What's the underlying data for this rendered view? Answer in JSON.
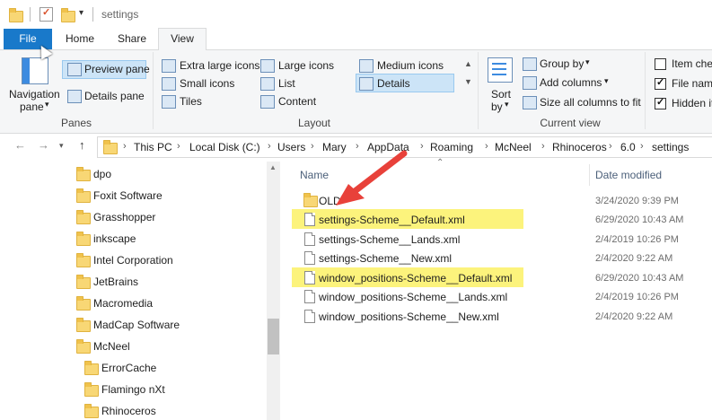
{
  "title_bar": {
    "path_label": "settings"
  },
  "tabs": [
    "File",
    "Home",
    "Share",
    "View"
  ],
  "ribbon": {
    "panes": {
      "navigation_pane_line1": "Navigation",
      "navigation_pane_line2": "pane",
      "preview_pane": "Preview pane",
      "details_pane": "Details pane",
      "label": "Panes"
    },
    "layout": {
      "items": [
        "Extra large icons",
        "Large icons",
        "Medium icons",
        "Small icons",
        "List",
        "Details",
        "Tiles",
        "Content"
      ],
      "selected": "Details",
      "label": "Layout"
    },
    "current_view": {
      "sort_by_line1": "Sort",
      "sort_by_line2": "by",
      "group_by": "Group by",
      "add_columns": "Add columns",
      "size_all_columns": "Size all columns to fit",
      "label": "Current view"
    },
    "show_hide": {
      "item_check_boxes": "Item chec",
      "file_name_extensions": "File nam",
      "hidden_items": "Hidden it"
    }
  },
  "address": {
    "crumbs": [
      "This PC",
      "Local Disk (C:)",
      "Users",
      "Mary",
      "AppData",
      "Roaming",
      "McNeel",
      "Rhinoceros",
      "6.0",
      "settings"
    ]
  },
  "nav_tree": [
    "dpo",
    "Foxit Software",
    "Grasshopper",
    "inkscape",
    "Intel Corporation",
    "JetBrains",
    "Macromedia",
    "MadCap Software",
    "McNeel",
    "ErrorCache",
    "Flamingo nXt",
    "Rhinoceros"
  ],
  "columns": {
    "name": "Name",
    "date_modified": "Date modified"
  },
  "files": [
    {
      "name": "OLD",
      "date": "3/24/2020 9:39 PM",
      "type": "folder",
      "highlight": false
    },
    {
      "name": "settings-Scheme__Default.xml",
      "date": "6/29/2020 10:43 AM",
      "type": "file",
      "highlight": true
    },
    {
      "name": "settings-Scheme__Lands.xml",
      "date": "2/4/2019 10:26 PM",
      "type": "file",
      "highlight": false
    },
    {
      "name": "settings-Scheme__New.xml",
      "date": "2/4/2020 9:22 AM",
      "type": "file",
      "highlight": false
    },
    {
      "name": "window_positions-Scheme__Default.xml",
      "date": "6/29/2020 10:43 AM",
      "type": "file",
      "highlight": true
    },
    {
      "name": "window_positions-Scheme__Lands.xml",
      "date": "2/4/2019 10:26 PM",
      "type": "file",
      "highlight": false
    },
    {
      "name": "window_positions-Scheme__New.xml",
      "date": "2/4/2020 9:22 AM",
      "type": "file",
      "highlight": false
    }
  ],
  "colors": {
    "file_tab": "#1979ca",
    "highlight": "#fcf37c",
    "arrow": "#e8413a",
    "folder": "#f8d775"
  }
}
